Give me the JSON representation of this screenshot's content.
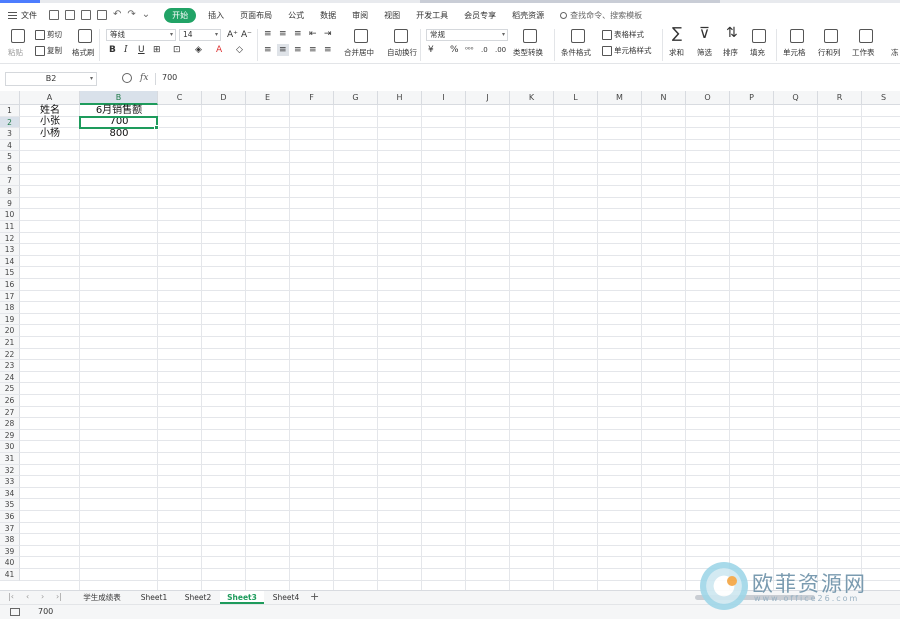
{
  "menu": {
    "file": "文件",
    "tabs": [
      "开始",
      "插入",
      "页面布局",
      "公式",
      "数据",
      "审阅",
      "视图",
      "开发工具",
      "会员专享",
      "稻壳资源"
    ],
    "search_placeholder": "查找命令、搜索模板"
  },
  "ribbon": {
    "paste": "粘贴",
    "cut": "剪切",
    "copy": "复制",
    "format_painter": "格式刷",
    "font_name": "等线",
    "font_size": "14",
    "merge_center": "合并居中",
    "wrap_text": "自动换行",
    "number_format": "常规",
    "type_convert": "类型转换",
    "conditional_format": "条件格式",
    "table_style": "表格样式",
    "cell_style": "单元格样式",
    "sum": "求和",
    "filter": "筛选",
    "sort": "排序",
    "fill": "填充",
    "cell": "单元格",
    "row_col": "行和列",
    "worksheet": "工作表",
    "freeze": "冻"
  },
  "formula_bar": {
    "name_box": "B2",
    "fx": "fx",
    "value": "700"
  },
  "sheet": {
    "columns": [
      "A",
      "B",
      "C",
      "D",
      "E",
      "F",
      "G",
      "H",
      "I",
      "J",
      "K",
      "L",
      "M",
      "N",
      "O",
      "P",
      "Q",
      "R",
      "S"
    ],
    "row_count": 41,
    "cells": {
      "A1": "姓名",
      "B1": "6月销售额",
      "A2": "小张",
      "B2": "700",
      "A3": "小杨",
      "B3": "800"
    },
    "selected": "B2"
  },
  "tabs": {
    "sheets": [
      "学生成绩表",
      "Sheet1",
      "Sheet2",
      "Sheet3",
      "Sheet4"
    ],
    "active": "Sheet3"
  },
  "status": {
    "value": "700"
  },
  "watermark": {
    "title": "欧菲资源网",
    "url": "www.office26.com"
  },
  "colors": {
    "accent": "#1e9b5c",
    "start_tab_bg": "#21a366"
  }
}
